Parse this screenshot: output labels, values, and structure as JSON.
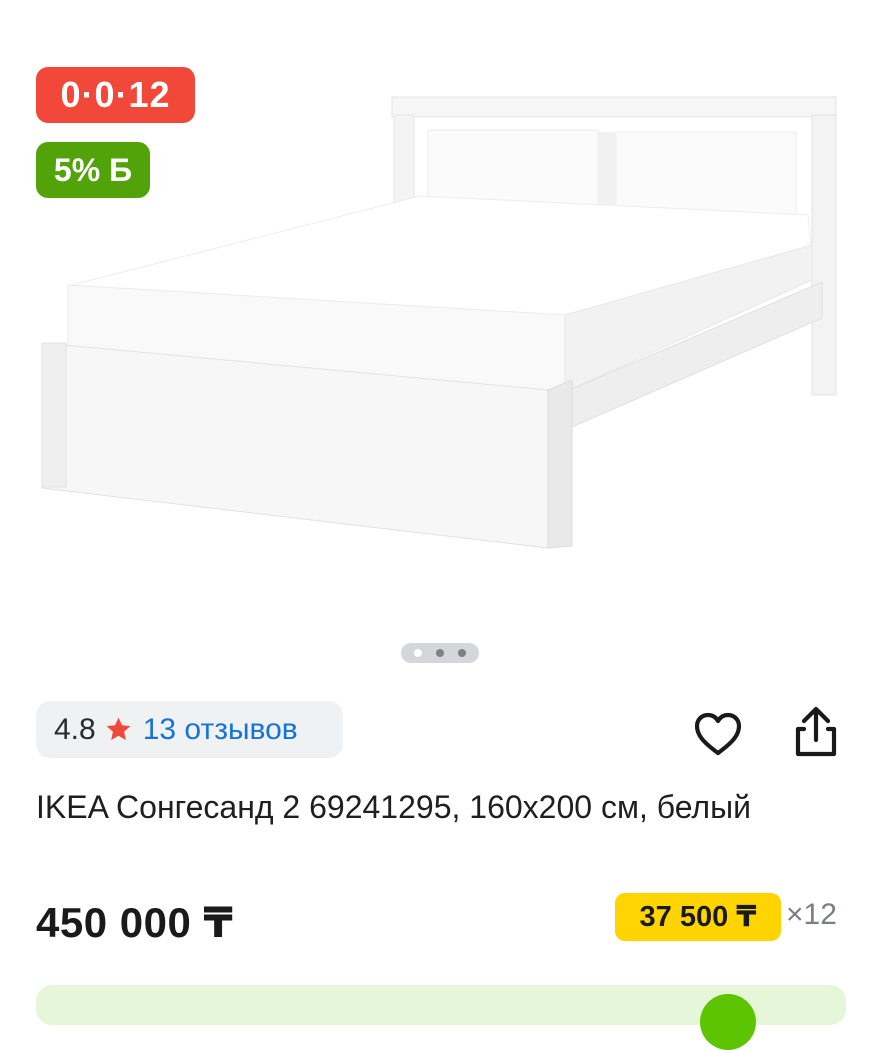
{
  "product_image": {
    "description": "bed-photo"
  },
  "badges": {
    "installment": "0·0·12",
    "bonus": "5% Б"
  },
  "gallery": {
    "pages": 3,
    "active_page": 1
  },
  "rating": {
    "value": "4.8",
    "reviews": "13 отзывов"
  },
  "product": {
    "title": "IKEA Сонгесанд 2 69241295, 160х200 см, белый",
    "price": "450 000 ₸",
    "monthly_payment": "37 500 ₸",
    "months": "×12"
  },
  "colors": {
    "installment_badge": "#f1483a",
    "bonus_badge": "#52a30a",
    "monthly_highlight": "#ffd400",
    "link": "#1474d9",
    "star": "#f1483a"
  },
  "icons": {
    "favorite": "heart-icon",
    "share": "share-icon",
    "rating": "star-icon"
  }
}
